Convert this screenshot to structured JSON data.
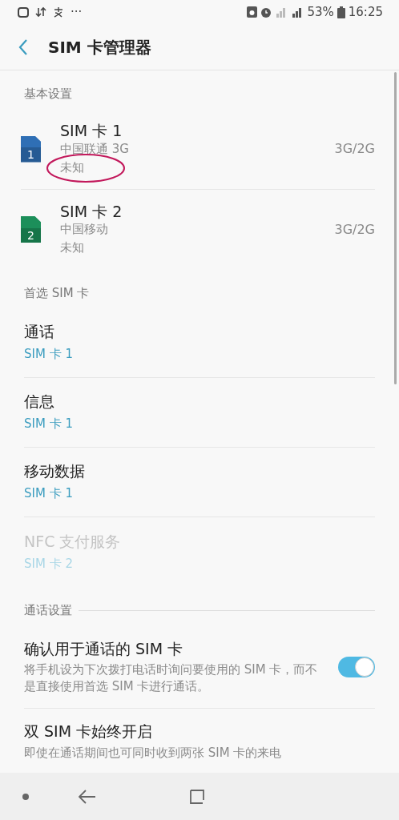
{
  "status_bar": {
    "more": "···",
    "battery": "53%",
    "time": "16:25"
  },
  "header": {
    "title": "SIM 卡管理器"
  },
  "sections": [
    {
      "title": "基本设置",
      "divider": false,
      "items": [
        {
          "kind": "sim",
          "name": "SIM 卡 1",
          "number": "1",
          "color": "#2f6fb5",
          "carrier": "中国联通 3G",
          "status": "未知",
          "network": "3G/2G",
          "circled": true
        },
        {
          "kind": "sim",
          "name": "SIM 卡 2",
          "number": "2",
          "color": "#1c8f5a",
          "carrier": "中国移动",
          "status": "未知",
          "network": "3G/2G",
          "circled": false
        }
      ]
    },
    {
      "title": "首选 SIM 卡",
      "divider": false,
      "items": [
        {
          "kind": "pref",
          "label": "通话",
          "value": "SIM 卡 1",
          "disabled": false
        },
        {
          "kind": "pref",
          "label": "信息",
          "value": "SIM 卡 1",
          "disabled": false
        },
        {
          "kind": "pref",
          "label": "移动数据",
          "value": "SIM 卡 1",
          "disabled": false
        },
        {
          "kind": "pref",
          "label": "NFC 支付服务",
          "value": "SIM 卡 2",
          "disabled": true
        }
      ]
    },
    {
      "title": "通话设置",
      "divider": true,
      "items": [
        {
          "kind": "toggle",
          "label": "确认用于通话的 SIM 卡",
          "description": "将手机设为下次拨打电话时询问要使用的 SIM 卡，而不是直接使用首选 SIM 卡进行通话。",
          "on": true
        },
        {
          "kind": "text",
          "label": "双 SIM 卡始终开启",
          "description": "即使在通话期间也可同时收到两张 SIM 卡的来电"
        }
      ]
    }
  ]
}
